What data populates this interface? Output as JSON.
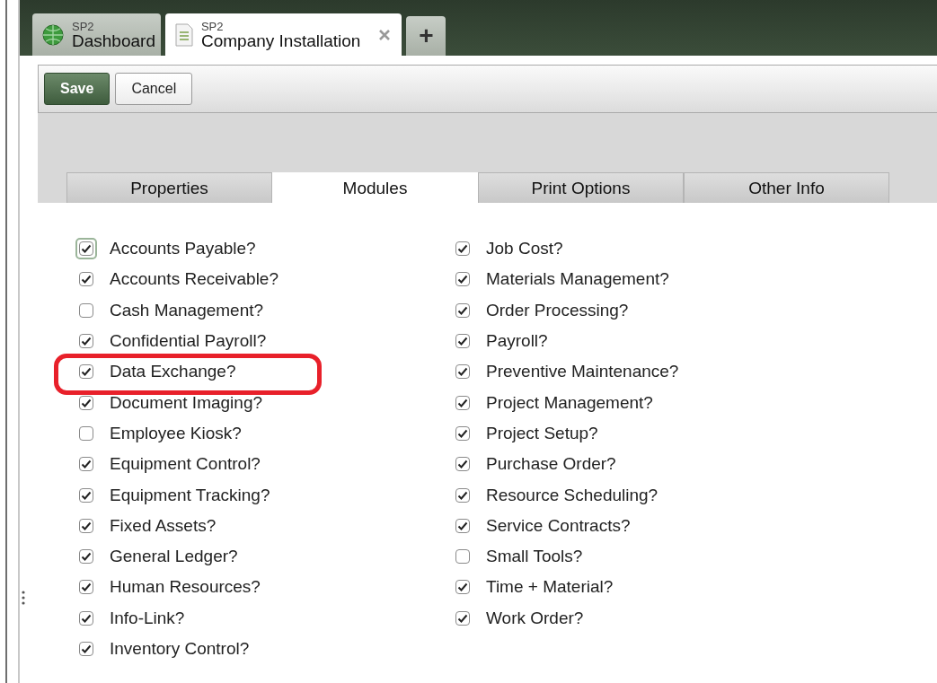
{
  "doc_tabs": [
    {
      "kind": "dashboard",
      "subtitle": "SP2",
      "title": "Dashboard",
      "selected": false,
      "closable": false
    },
    {
      "kind": "document",
      "subtitle": "SP2",
      "title": "Company Installation",
      "selected": true,
      "closable": true
    }
  ],
  "new_tab_button": {
    "label": "+"
  },
  "toolbar": {
    "buttons": [
      {
        "label": "Save",
        "kind": "primary"
      },
      {
        "label": "Cancel",
        "kind": "normal"
      }
    ]
  },
  "tabs": [
    {
      "label": "Properties",
      "selected": false
    },
    {
      "label": "Modules",
      "selected": true
    },
    {
      "label": "Print Options",
      "selected": false
    },
    {
      "label": "Other Info",
      "selected": false
    }
  ],
  "modules_columns": [
    [
      {
        "label": "Accounts Payable?",
        "checked": true,
        "focused": true,
        "highlighted": false
      },
      {
        "label": "Accounts Receivable?",
        "checked": true,
        "focused": false,
        "highlighted": false
      },
      {
        "label": "Cash Management?",
        "checked": false,
        "focused": false,
        "highlighted": false
      },
      {
        "label": "Confidential Payroll?",
        "checked": true,
        "focused": false,
        "highlighted": false
      },
      {
        "label": "Data Exchange?",
        "checked": true,
        "focused": false,
        "highlighted": true
      },
      {
        "label": "Document Imaging?",
        "checked": true,
        "focused": false,
        "highlighted": false
      },
      {
        "label": "Employee Kiosk?",
        "checked": false,
        "focused": false,
        "highlighted": false
      },
      {
        "label": "Equipment Control?",
        "checked": true,
        "focused": false,
        "highlighted": false
      },
      {
        "label": "Equipment Tracking?",
        "checked": true,
        "focused": false,
        "highlighted": false
      },
      {
        "label": "Fixed Assets?",
        "checked": true,
        "focused": false,
        "highlighted": false
      },
      {
        "label": "General Ledger?",
        "checked": true,
        "focused": false,
        "highlighted": false
      },
      {
        "label": "Human Resources?",
        "checked": true,
        "focused": false,
        "highlighted": false
      },
      {
        "label": "Info-Link?",
        "checked": true,
        "focused": false,
        "highlighted": false
      },
      {
        "label": "Inventory Control?",
        "checked": true,
        "focused": false,
        "highlighted": false
      }
    ],
    [
      {
        "label": "Job Cost?",
        "checked": true,
        "focused": false,
        "highlighted": false
      },
      {
        "label": "Materials Management?",
        "checked": true,
        "focused": false,
        "highlighted": false
      },
      {
        "label": "Order Processing?",
        "checked": true,
        "focused": false,
        "highlighted": false
      },
      {
        "label": "Payroll?",
        "checked": true,
        "focused": false,
        "highlighted": false
      },
      {
        "label": "Preventive Maintenance?",
        "checked": true,
        "focused": false,
        "highlighted": false
      },
      {
        "label": "Project Management?",
        "checked": true,
        "focused": false,
        "highlighted": false
      },
      {
        "label": "Project Setup?",
        "checked": true,
        "focused": false,
        "highlighted": false
      },
      {
        "label": "Purchase Order?",
        "checked": true,
        "focused": false,
        "highlighted": false
      },
      {
        "label": "Resource Scheduling?",
        "checked": true,
        "focused": false,
        "highlighted": false
      },
      {
        "label": "Service Contracts?",
        "checked": true,
        "focused": false,
        "highlighted": false
      },
      {
        "label": "Small Tools?",
        "checked": false,
        "focused": false,
        "highlighted": false
      },
      {
        "label": "Time + Material?",
        "checked": true,
        "focused": false,
        "highlighted": false
      },
      {
        "label": "Work Order?",
        "checked": true,
        "focused": false,
        "highlighted": false
      }
    ]
  ]
}
